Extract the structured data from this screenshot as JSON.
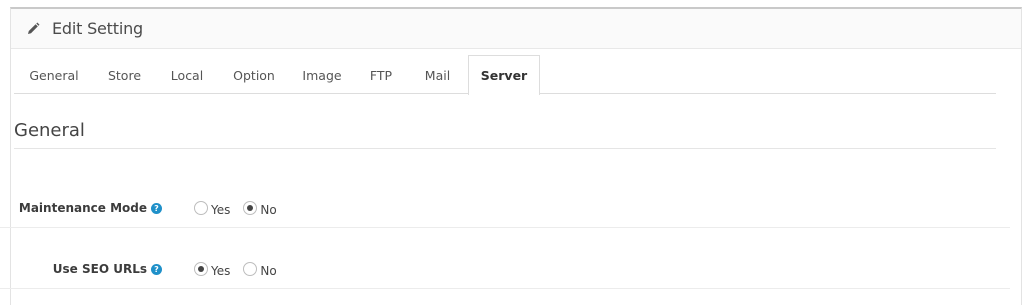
{
  "header": {
    "title": "Edit Setting",
    "icon": "pencil-icon"
  },
  "tabs": [
    {
      "label": "General"
    },
    {
      "label": "Store"
    },
    {
      "label": "Local"
    },
    {
      "label": "Option"
    },
    {
      "label": "Image"
    },
    {
      "label": "FTP"
    },
    {
      "label": "Mail"
    },
    {
      "label": "Server"
    }
  ],
  "active_tab": "Server",
  "section": {
    "title": "General"
  },
  "fields": {
    "maintenance": {
      "label": "Maintenance Mode",
      "help": "?",
      "yes": "Yes",
      "no": "No",
      "value": "No"
    },
    "seo_urls": {
      "label": "Use SEO URLs",
      "help": "?",
      "yes": "Yes",
      "no": "No",
      "value": "Yes"
    }
  },
  "colors": {
    "help_icon": "#1f90c9",
    "border": "#dddddd"
  }
}
